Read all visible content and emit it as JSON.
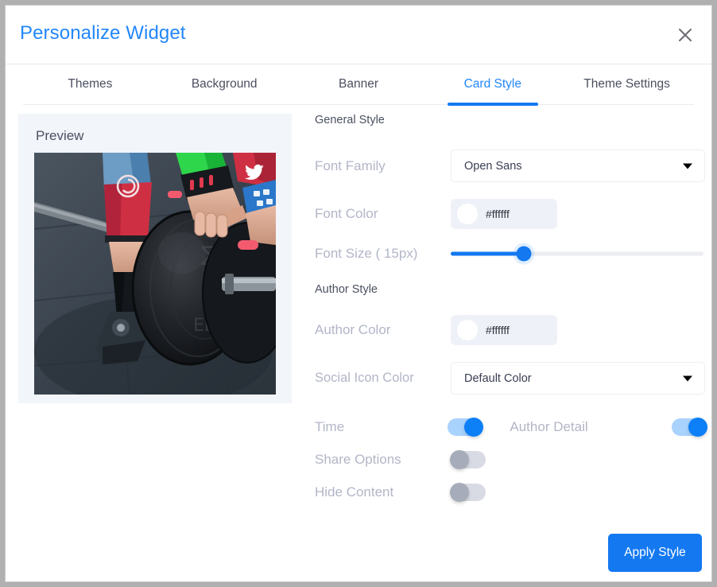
{
  "dialog": {
    "title": "Personalize Widget",
    "close_icon": "close-icon",
    "accent_color": "#1479f1",
    "title_color": "#2287fb"
  },
  "tabs": [
    {
      "label": "Themes",
      "active": false
    },
    {
      "label": "Background",
      "active": false
    },
    {
      "label": "Banner",
      "active": false
    },
    {
      "label": "Card Style",
      "active": true
    },
    {
      "label": "Theme Settings",
      "active": false
    }
  ],
  "preview": {
    "label": "Preview",
    "social_icon": "twitter-icon",
    "image_alt": "weightlifter lifting loaded barbell in gym"
  },
  "sections": {
    "general": {
      "heading": "General Style",
      "font_family": {
        "label": "Font Family",
        "value": "Open Sans",
        "arrow_icon": "chevron-down-icon"
      },
      "font_color": {
        "label": "Font Color",
        "value": "#ffffff",
        "swatch": "#ffffff"
      },
      "font_size": {
        "label": "Font Size ( 15px)",
        "value": 15,
        "percent": 29
      }
    },
    "author": {
      "heading": "Author Style",
      "author_color": {
        "label": "Author Color",
        "value": "#ffffff",
        "swatch": "#ffffff"
      },
      "social_icon_color": {
        "label": "Social Icon Color",
        "value": "Default Color",
        "arrow_icon": "chevron-down-icon"
      }
    }
  },
  "toggles": {
    "time": {
      "label": "Time",
      "on": true
    },
    "author_detail": {
      "label": "Author Detail",
      "on": true
    },
    "share_options": {
      "label": "Share Options",
      "on": false
    },
    "hide_content": {
      "label": "Hide Content",
      "on": false
    }
  },
  "footer": {
    "apply_label": "Apply Style"
  }
}
